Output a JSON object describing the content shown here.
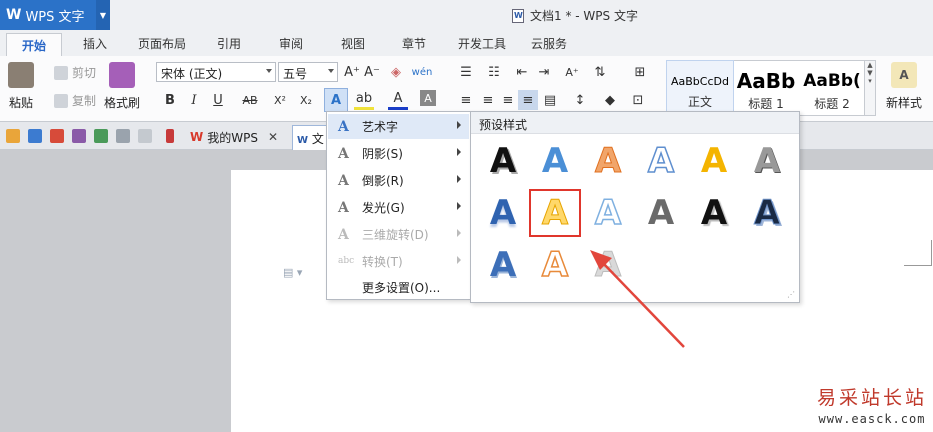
{
  "app": {
    "name": "WPS 文字",
    "logo": "W"
  },
  "window": {
    "title": "文档1 * - WPS 文字"
  },
  "tabs": [
    "开始",
    "插入",
    "页面布局",
    "引用",
    "审阅",
    "视图",
    "章节",
    "开发工具",
    "云服务"
  ],
  "ribbon": {
    "paste": "粘贴",
    "cut": "剪切",
    "copy": "复制",
    "format_painter": "格式刷",
    "font_name": "宋体 (正文)",
    "font_size": "五号",
    "styles": [
      {
        "sample": "AaBbCcDd",
        "name": "正文"
      },
      {
        "sample": "AaBb",
        "name": "标题 1"
      },
      {
        "sample": "AaBb(",
        "name": "标题 2"
      }
    ],
    "new_style": "新样式"
  },
  "quickbar": {
    "wps_tab": "我的WPS",
    "doc_tab": "文"
  },
  "menu": {
    "items": [
      {
        "label": "艺术字",
        "icon": "A"
      },
      {
        "label": "阴影(S)",
        "icon": "A"
      },
      {
        "label": "倒影(R)",
        "icon": "A"
      },
      {
        "label": "发光(G)",
        "icon": "A"
      },
      {
        "label": "三维旋转(D)",
        "icon": "A"
      },
      {
        "label": "转换(T)",
        "icon": "abc"
      },
      {
        "label": "更多设置(O)..."
      }
    ]
  },
  "preset": {
    "title": "预设样式",
    "letter": "A"
  },
  "watermark": {
    "cn": "易采站长站",
    "en": "www.easck.com"
  },
  "colors": {
    "accent": "#2b72c8",
    "highlight": "#e0362c"
  }
}
